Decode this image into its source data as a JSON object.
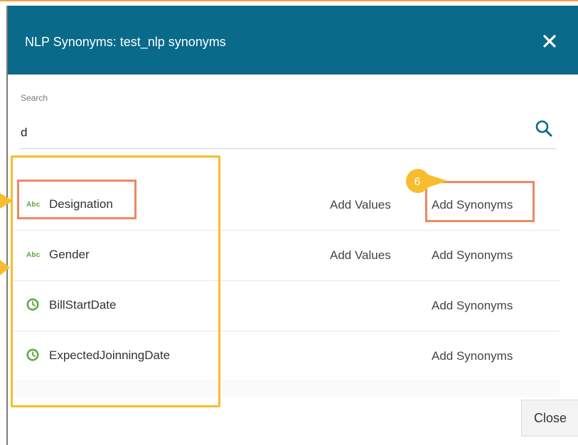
{
  "dialog": {
    "title": "NLP Synonyms: test_nlp synonyms",
    "close_icon": "close-icon",
    "header_color": "#0a6a8a"
  },
  "search": {
    "label": "Search",
    "value": "d",
    "icon": "search-icon"
  },
  "fields": [
    {
      "type_icon": "abc-text-icon",
      "type_label": "Abc",
      "name": "Designation",
      "add_values": "Add Values",
      "add_synonyms": "Add Synonyms"
    },
    {
      "type_icon": "abc-text-icon",
      "type_label": "Abc",
      "name": "Gender",
      "add_values": "Add Values",
      "add_synonyms": "Add Synonyms"
    },
    {
      "type_icon": "clock-icon",
      "name": "BillStartDate",
      "add_synonyms": "Add Synonyms"
    },
    {
      "type_icon": "clock-icon",
      "name": "ExpectedJoinningDate",
      "add_synonyms": "Add Synonyms"
    }
  ],
  "footer": {
    "close_label": "Close"
  },
  "annotations": {
    "step_number": "6",
    "highlight_yellow": "#f7bd2c",
    "highlight_orange": "#ee8863"
  }
}
